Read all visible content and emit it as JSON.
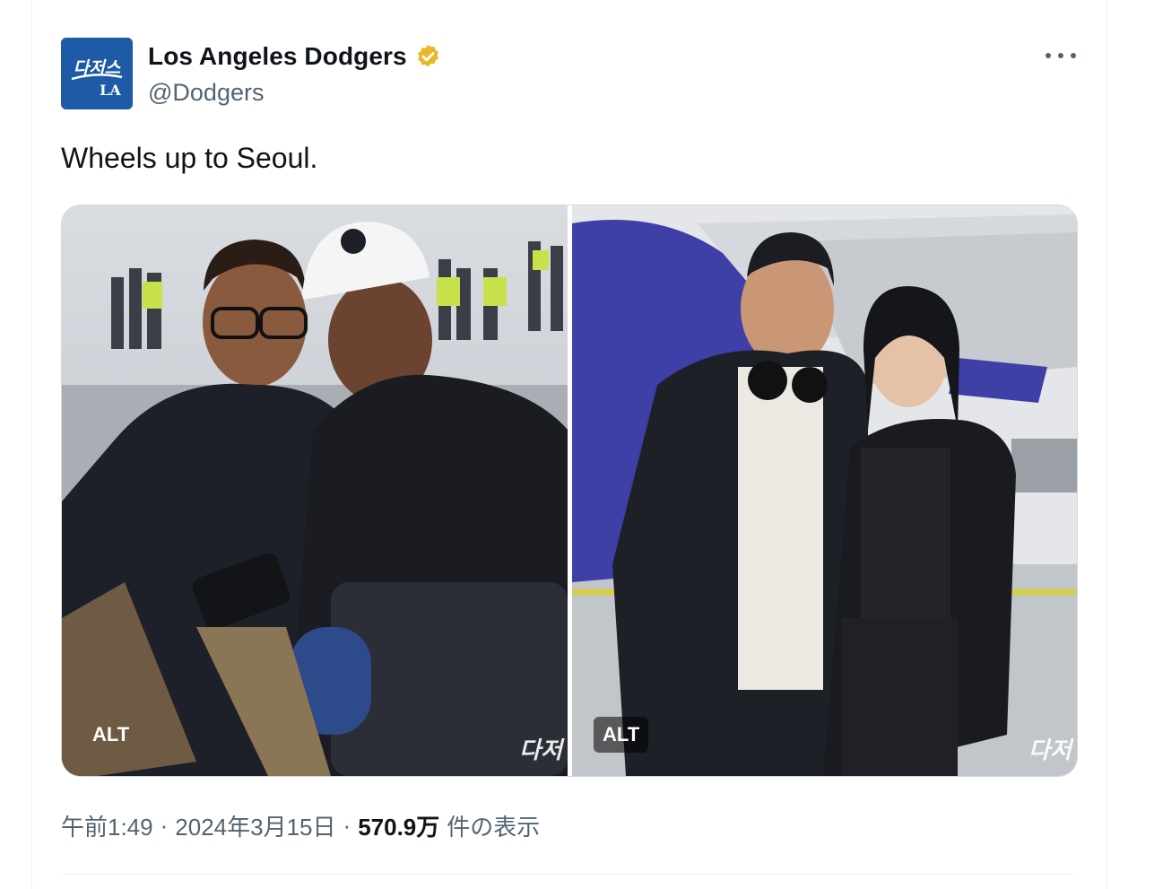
{
  "tweet": {
    "author": {
      "display_name": "Los Angeles Dodgers",
      "handle": "@Dodgers",
      "avatar_text": "다저스",
      "avatar_logo": "LA",
      "verified": true,
      "verified_color": "#e8b829"
    },
    "text": "Wheels up to Seoul.",
    "media": [
      {
        "alt_label": "ALT",
        "watermark": "다저"
      },
      {
        "alt_label": "ALT",
        "watermark": "다저"
      }
    ],
    "time": "午前1:49",
    "date": "2024年3月15日",
    "separator": "·",
    "views_count": "570.9万",
    "views_label": "件の表示"
  },
  "colors": {
    "text_primary": "#0f1419",
    "text_secondary": "#536471",
    "avatar_bg": "#1f5aa6",
    "border": "#eff3f4"
  },
  "icons": {
    "verified": "verified-badge-icon",
    "more": "more-horizontal-icon"
  }
}
